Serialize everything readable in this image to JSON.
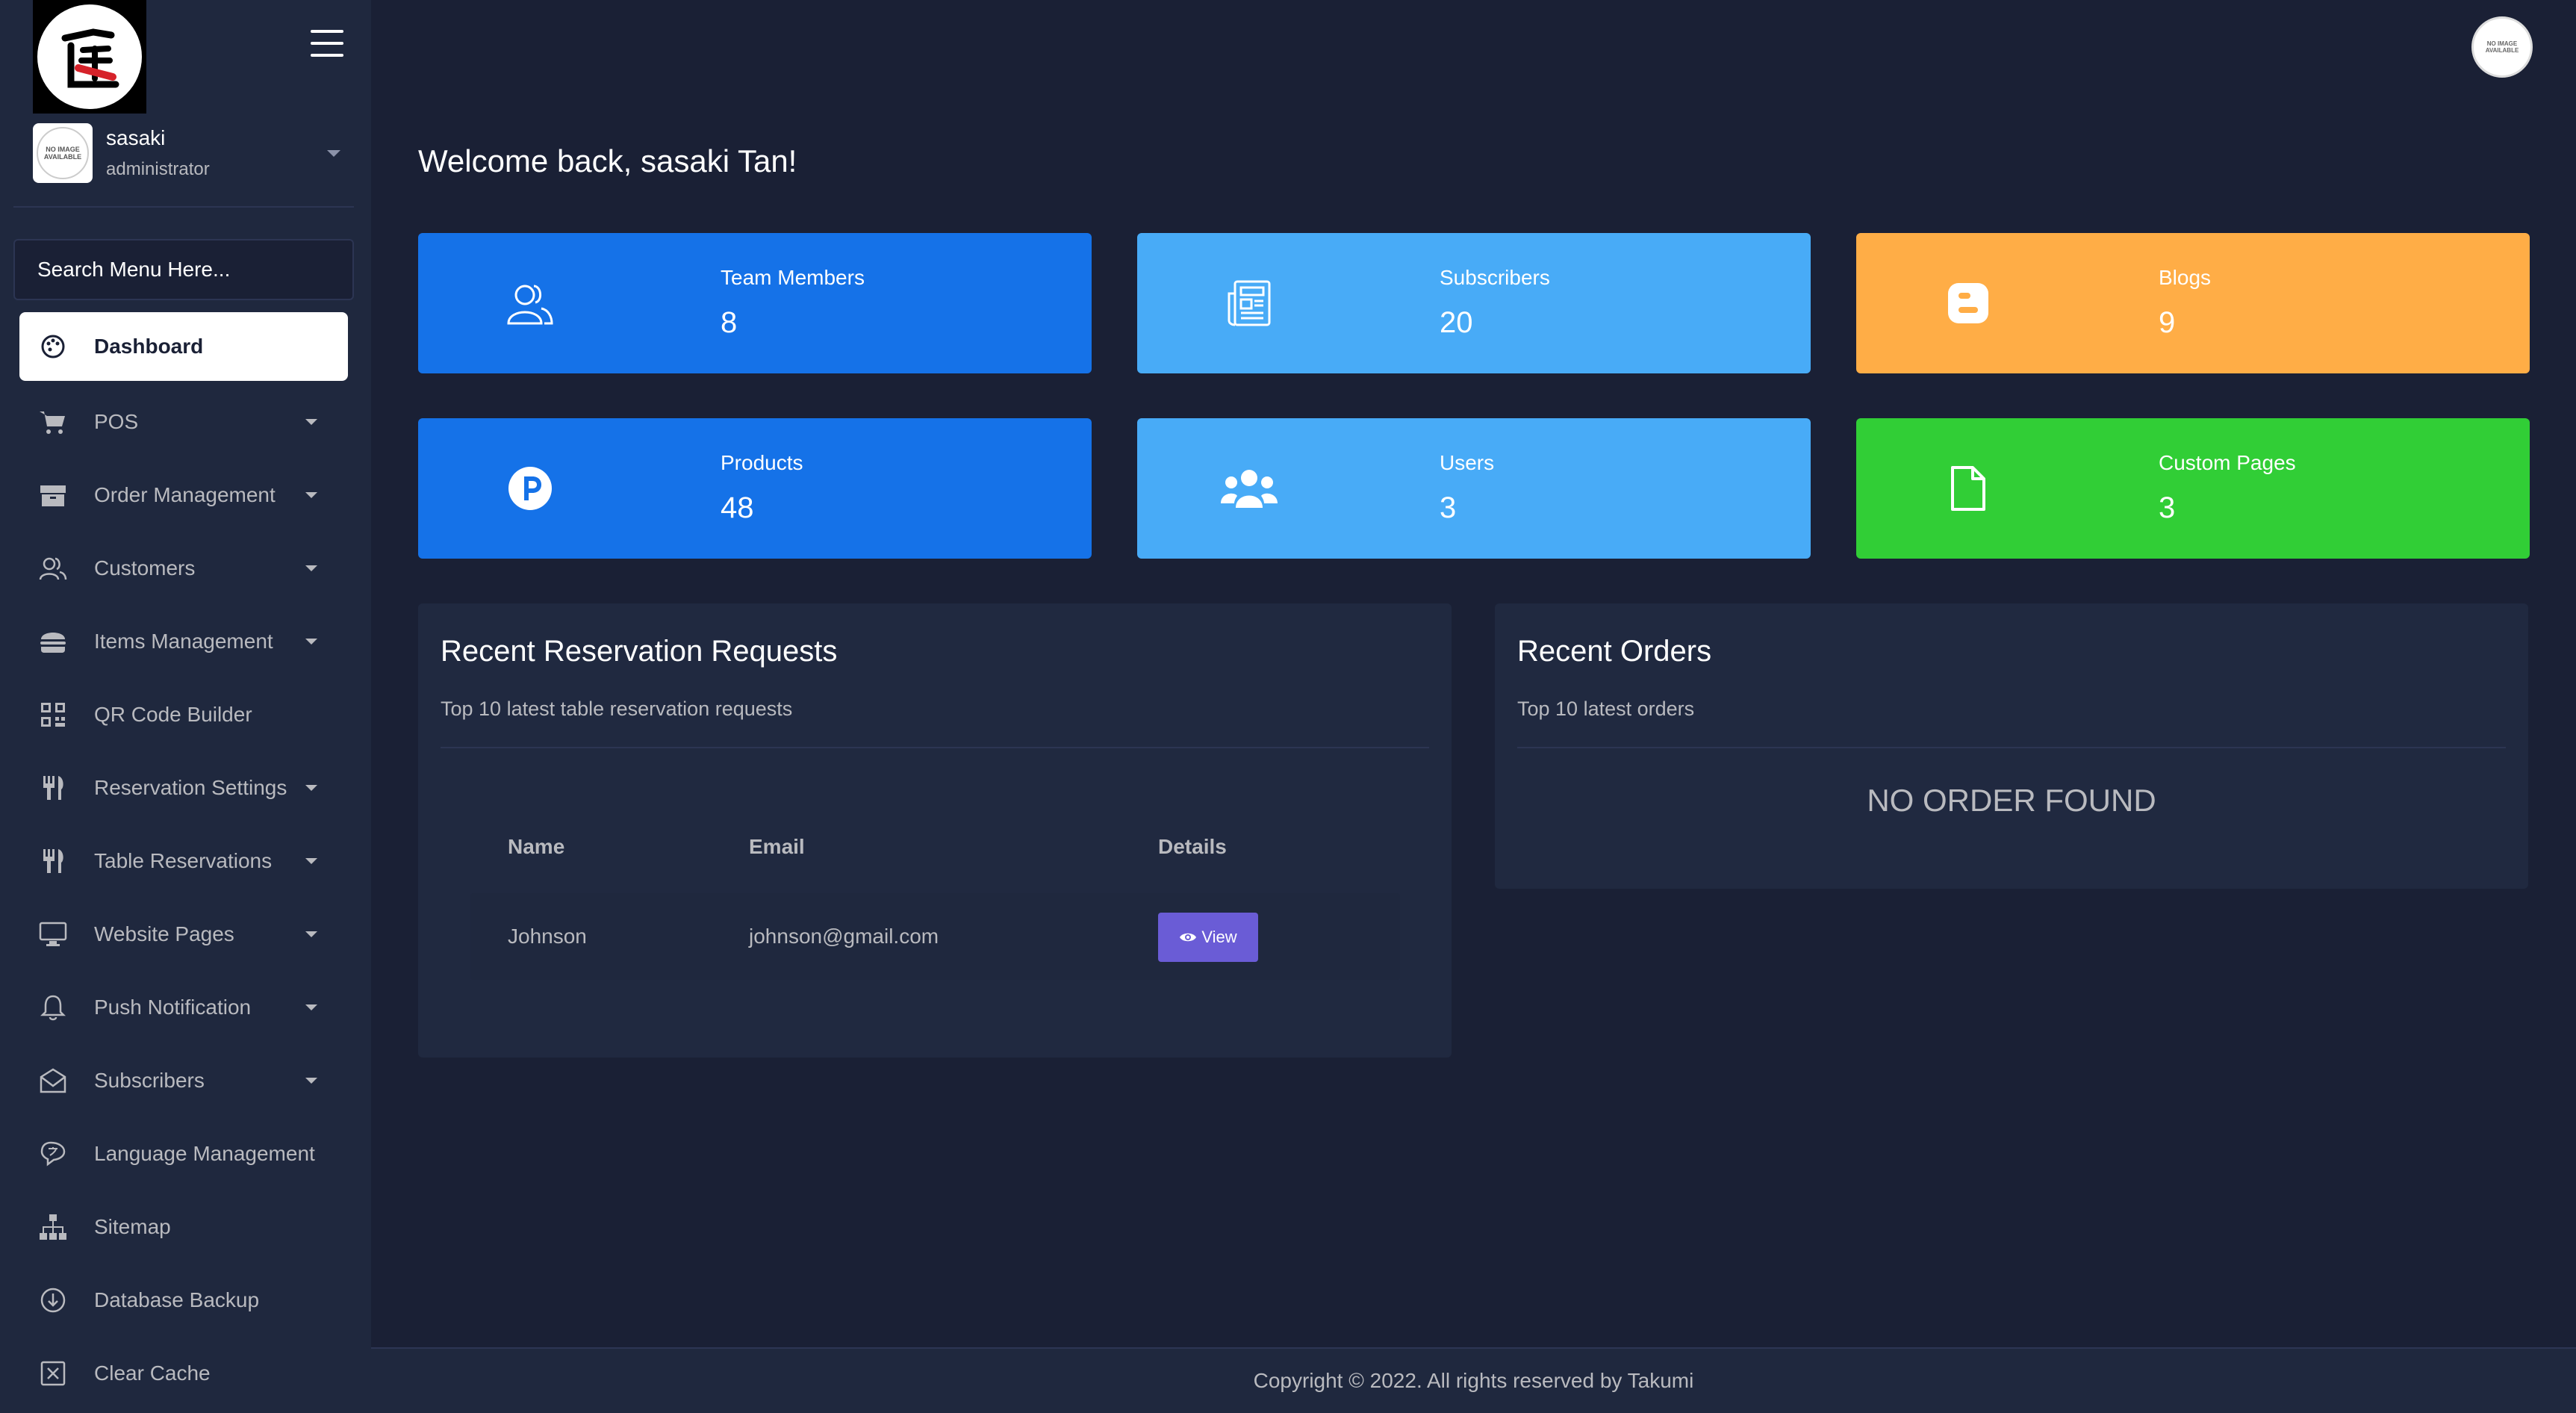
{
  "sidebar": {
    "user": {
      "name": "sasaki",
      "role": "administrator",
      "avatar_text": "NO IMAGE AVAILABLE"
    },
    "search_placeholder": "Search Menu Here...",
    "items": [
      {
        "label": "Dashboard",
        "icon": "palette-icon",
        "active": true,
        "has_caret": false
      },
      {
        "label": "POS",
        "icon": "cart-icon",
        "has_caret": true
      },
      {
        "label": "Order Management",
        "icon": "box-icon",
        "has_caret": true
      },
      {
        "label": "Customers",
        "icon": "users-outline-icon",
        "has_caret": true
      },
      {
        "label": "Items Management",
        "icon": "burger-icon",
        "has_caret": true
      },
      {
        "label": "QR Code Builder",
        "icon": "qrcode-icon",
        "has_caret": false
      },
      {
        "label": "Reservation Settings",
        "icon": "utensils-icon",
        "has_caret": true
      },
      {
        "label": "Table Reservations",
        "icon": "utensils-icon",
        "has_caret": true
      },
      {
        "label": "Website Pages",
        "icon": "monitor-icon",
        "has_caret": true
      },
      {
        "label": "Push Notification",
        "icon": "bell-icon",
        "has_caret": true
      },
      {
        "label": "Subscribers",
        "icon": "mail-icon",
        "has_caret": true
      },
      {
        "label": "Language Management",
        "icon": "language-icon",
        "has_caret": false
      },
      {
        "label": "Sitemap",
        "icon": "sitemap-icon",
        "has_caret": false
      },
      {
        "label": "Database Backup",
        "icon": "download-icon",
        "has_caret": false
      },
      {
        "label": "Clear Cache",
        "icon": "clear-icon",
        "has_caret": false
      }
    ]
  },
  "topbar": {
    "avatar_text": "NO IMAGE AVAILABLE"
  },
  "welcome": "Welcome back, sasaki Tan!",
  "cards": [
    {
      "label": "Team Members",
      "value": "8",
      "color": "#1572e8",
      "icon": "team-icon"
    },
    {
      "label": "Subscribers",
      "value": "20",
      "color": "#48abf7",
      "icon": "newspaper-icon"
    },
    {
      "label": "Blogs",
      "value": "9",
      "color": "#ffad46",
      "icon": "blogger-icon"
    },
    {
      "label": "Products",
      "value": "48",
      "color": "#1572e8",
      "icon": "product-p-icon"
    },
    {
      "label": "Users",
      "value": "3",
      "color": "#48abf7",
      "icon": "users-icon"
    },
    {
      "label": "Custom Pages",
      "value": "3",
      "color": "#31ce36",
      "icon": "file-icon"
    }
  ],
  "reservations": {
    "title": "Recent Reservation Requests",
    "subtitle": "Top 10 latest table reservation requests",
    "columns": [
      "Name",
      "Email",
      "Details"
    ],
    "rows": [
      {
        "name": "Johnson",
        "email": "johnson@gmail.com",
        "action": "View"
      }
    ]
  },
  "orders": {
    "title": "Recent Orders",
    "subtitle": "Top 10 latest orders",
    "empty_text": "NO ORDER FOUND"
  },
  "footer": "Copyright © 2022. All rights reserved by Takumi"
}
